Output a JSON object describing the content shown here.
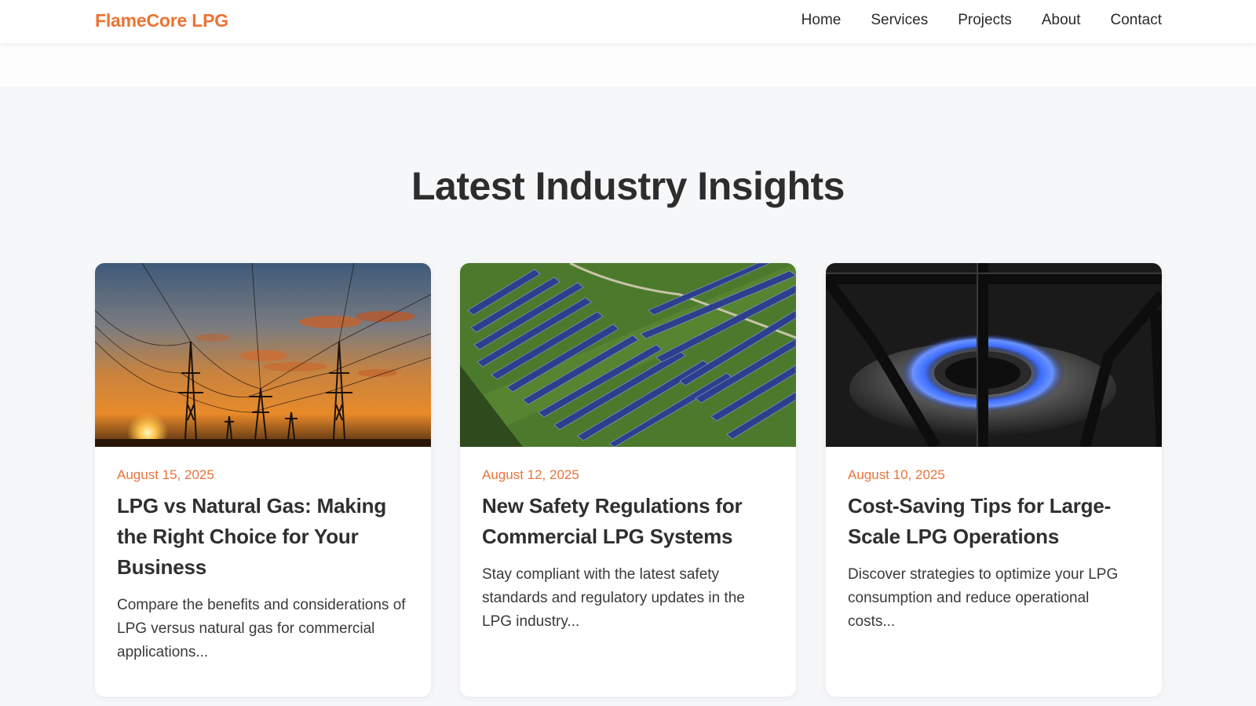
{
  "header": {
    "brand": "FlameCore LPG",
    "nav": [
      {
        "label": "Home"
      },
      {
        "label": "Services"
      },
      {
        "label": "Projects"
      },
      {
        "label": "About"
      },
      {
        "label": "Contact"
      }
    ]
  },
  "insights": {
    "title": "Latest Industry Insights",
    "posts": [
      {
        "date": "August 15, 2025",
        "title": "LPG vs Natural Gas: Making the Right Choice for Your Business",
        "excerpt": "Compare the benefits and considerations of LPG versus natural gas for commercial applications...",
        "image": "power-lines-sunset-photo"
      },
      {
        "date": "August 12, 2025",
        "title": "New Safety Regulations for Commercial LPG Systems",
        "excerpt": "Stay compliant with the latest safety standards and regulatory updates in the LPG industry...",
        "image": "solar-farm-aerial-photo"
      },
      {
        "date": "August 10, 2025",
        "title": "Cost-Saving Tips for Large-Scale LPG Operations",
        "excerpt": "Discover strategies to optimize your LPG consumption and reduce operational costs...",
        "image": "gas-burner-flame-photo"
      }
    ]
  },
  "colors": {
    "accent": "#ee7233",
    "date": "#e8743b",
    "page_bg": "#f6f7f9",
    "card_bg": "#ffffff"
  }
}
